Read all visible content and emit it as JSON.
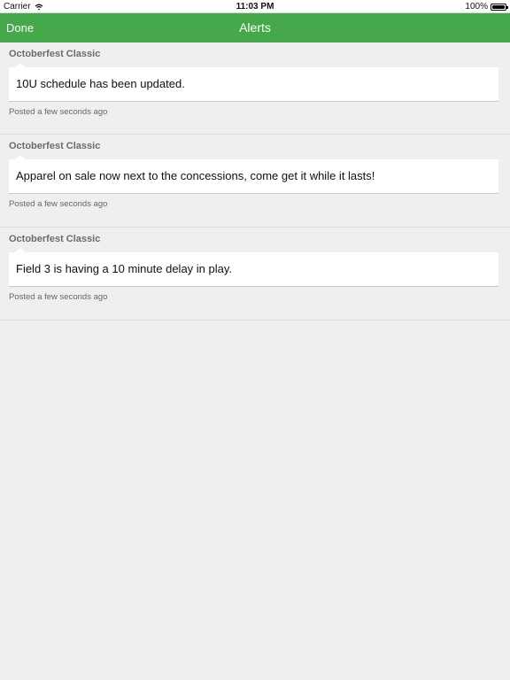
{
  "status_bar": {
    "carrier": "Carrier",
    "time": "11:03 PM",
    "battery": "100%",
    "icons": [
      "wifi-icon",
      "battery-icon"
    ]
  },
  "nav": {
    "done_label": "Done",
    "title": "Alerts"
  },
  "colors": {
    "accent": "#45a84b",
    "background": "#efefef",
    "card": "#ffffff"
  },
  "alerts": [
    {
      "source": "Octoberfest Classic",
      "message": "10U schedule has been updated.",
      "meta": "Posted a few seconds ago"
    },
    {
      "source": "Octoberfest Classic",
      "message": "Apparel on sale now next to the concessions, come get it while it lasts!",
      "meta": "Posted a few seconds ago"
    },
    {
      "source": "Octoberfest Classic",
      "message": "Field 3 is having a 10 minute delay in play.",
      "meta": "Posted a few seconds ago"
    }
  ]
}
